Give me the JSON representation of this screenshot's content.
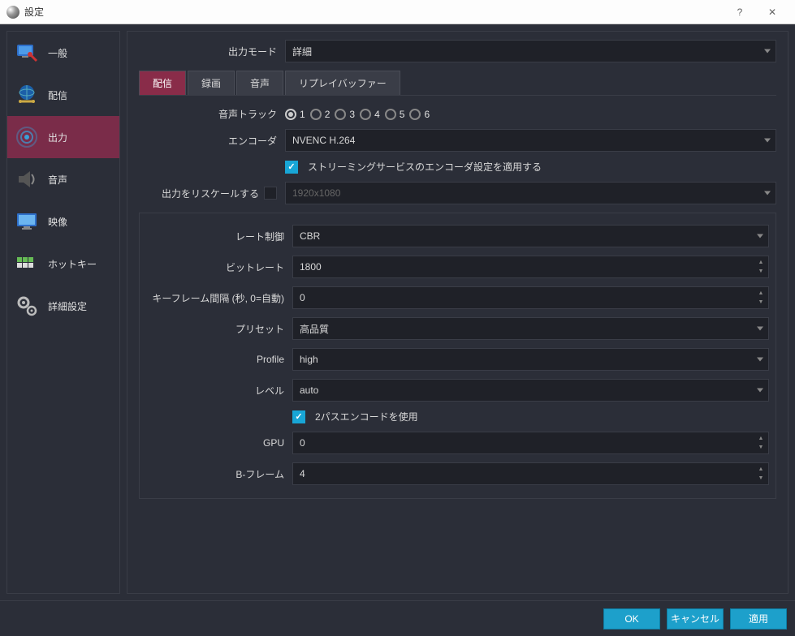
{
  "window": {
    "title": "設定",
    "help": "?",
    "close": "✕"
  },
  "sidebar": {
    "items": [
      {
        "label": "一般"
      },
      {
        "label": "配信"
      },
      {
        "label": "出力"
      },
      {
        "label": "音声"
      },
      {
        "label": "映像"
      },
      {
        "label": "ホットキー"
      },
      {
        "label": "詳細設定"
      }
    ]
  },
  "output_mode": {
    "label": "出力モード",
    "value": "詳細"
  },
  "tabs": {
    "items": [
      {
        "label": "配信"
      },
      {
        "label": "録画"
      },
      {
        "label": "音声"
      },
      {
        "label": "リプレイバッファー"
      }
    ]
  },
  "fields": {
    "audio_track": {
      "label": "音声トラック",
      "options": [
        "1",
        "2",
        "3",
        "4",
        "5",
        "6"
      ],
      "selected": "1"
    },
    "encoder": {
      "label": "エンコーダ",
      "value": "NVENC H.264"
    },
    "apply_service": {
      "label": "ストリーミングサービスのエンコーダ設定を適用する",
      "checked": true
    },
    "rescale": {
      "label": "出力をリスケールする",
      "checked": false,
      "value": "1920x1080"
    },
    "rate_control": {
      "label": "レート制御",
      "value": "CBR"
    },
    "bitrate": {
      "label": "ビットレート",
      "value": "1800"
    },
    "keyframe": {
      "label": "キーフレーム間隔 (秒, 0=自動)",
      "value": "0"
    },
    "preset": {
      "label": "プリセット",
      "value": "高品質"
    },
    "profile": {
      "label": "Profile",
      "value": "high"
    },
    "level": {
      "label": "レベル",
      "value": "auto"
    },
    "two_pass": {
      "label": "2パスエンコードを使用",
      "checked": true
    },
    "gpu": {
      "label": "GPU",
      "value": "0"
    },
    "bframes": {
      "label": "B-フレーム",
      "value": "4"
    }
  },
  "buttons": {
    "ok": "OK",
    "cancel": "キャンセル",
    "apply": "適用"
  }
}
